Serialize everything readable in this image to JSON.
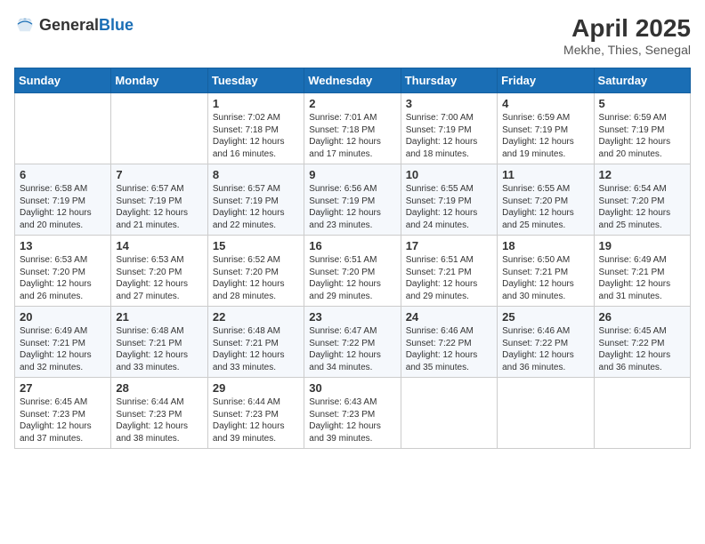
{
  "header": {
    "logo_general": "General",
    "logo_blue": "Blue",
    "month_year": "April 2025",
    "location": "Mekhe, Thies, Senegal"
  },
  "weekdays": [
    "Sunday",
    "Monday",
    "Tuesday",
    "Wednesday",
    "Thursday",
    "Friday",
    "Saturday"
  ],
  "weeks": [
    [
      {
        "day": "",
        "sunrise": "",
        "sunset": "",
        "daylight": ""
      },
      {
        "day": "",
        "sunrise": "",
        "sunset": "",
        "daylight": ""
      },
      {
        "day": "1",
        "sunrise": "Sunrise: 7:02 AM",
        "sunset": "Sunset: 7:18 PM",
        "daylight": "Daylight: 12 hours and 16 minutes."
      },
      {
        "day": "2",
        "sunrise": "Sunrise: 7:01 AM",
        "sunset": "Sunset: 7:18 PM",
        "daylight": "Daylight: 12 hours and 17 minutes."
      },
      {
        "day": "3",
        "sunrise": "Sunrise: 7:00 AM",
        "sunset": "Sunset: 7:19 PM",
        "daylight": "Daylight: 12 hours and 18 minutes."
      },
      {
        "day": "4",
        "sunrise": "Sunrise: 6:59 AM",
        "sunset": "Sunset: 7:19 PM",
        "daylight": "Daylight: 12 hours and 19 minutes."
      },
      {
        "day": "5",
        "sunrise": "Sunrise: 6:59 AM",
        "sunset": "Sunset: 7:19 PM",
        "daylight": "Daylight: 12 hours and 20 minutes."
      }
    ],
    [
      {
        "day": "6",
        "sunrise": "Sunrise: 6:58 AM",
        "sunset": "Sunset: 7:19 PM",
        "daylight": "Daylight: 12 hours and 20 minutes."
      },
      {
        "day": "7",
        "sunrise": "Sunrise: 6:57 AM",
        "sunset": "Sunset: 7:19 PM",
        "daylight": "Daylight: 12 hours and 21 minutes."
      },
      {
        "day": "8",
        "sunrise": "Sunrise: 6:57 AM",
        "sunset": "Sunset: 7:19 PM",
        "daylight": "Daylight: 12 hours and 22 minutes."
      },
      {
        "day": "9",
        "sunrise": "Sunrise: 6:56 AM",
        "sunset": "Sunset: 7:19 PM",
        "daylight": "Daylight: 12 hours and 23 minutes."
      },
      {
        "day": "10",
        "sunrise": "Sunrise: 6:55 AM",
        "sunset": "Sunset: 7:19 PM",
        "daylight": "Daylight: 12 hours and 24 minutes."
      },
      {
        "day": "11",
        "sunrise": "Sunrise: 6:55 AM",
        "sunset": "Sunset: 7:20 PM",
        "daylight": "Daylight: 12 hours and 25 minutes."
      },
      {
        "day": "12",
        "sunrise": "Sunrise: 6:54 AM",
        "sunset": "Sunset: 7:20 PM",
        "daylight": "Daylight: 12 hours and 25 minutes."
      }
    ],
    [
      {
        "day": "13",
        "sunrise": "Sunrise: 6:53 AM",
        "sunset": "Sunset: 7:20 PM",
        "daylight": "Daylight: 12 hours and 26 minutes."
      },
      {
        "day": "14",
        "sunrise": "Sunrise: 6:53 AM",
        "sunset": "Sunset: 7:20 PM",
        "daylight": "Daylight: 12 hours and 27 minutes."
      },
      {
        "day": "15",
        "sunrise": "Sunrise: 6:52 AM",
        "sunset": "Sunset: 7:20 PM",
        "daylight": "Daylight: 12 hours and 28 minutes."
      },
      {
        "day": "16",
        "sunrise": "Sunrise: 6:51 AM",
        "sunset": "Sunset: 7:20 PM",
        "daylight": "Daylight: 12 hours and 29 minutes."
      },
      {
        "day": "17",
        "sunrise": "Sunrise: 6:51 AM",
        "sunset": "Sunset: 7:21 PM",
        "daylight": "Daylight: 12 hours and 29 minutes."
      },
      {
        "day": "18",
        "sunrise": "Sunrise: 6:50 AM",
        "sunset": "Sunset: 7:21 PM",
        "daylight": "Daylight: 12 hours and 30 minutes."
      },
      {
        "day": "19",
        "sunrise": "Sunrise: 6:49 AM",
        "sunset": "Sunset: 7:21 PM",
        "daylight": "Daylight: 12 hours and 31 minutes."
      }
    ],
    [
      {
        "day": "20",
        "sunrise": "Sunrise: 6:49 AM",
        "sunset": "Sunset: 7:21 PM",
        "daylight": "Daylight: 12 hours and 32 minutes."
      },
      {
        "day": "21",
        "sunrise": "Sunrise: 6:48 AM",
        "sunset": "Sunset: 7:21 PM",
        "daylight": "Daylight: 12 hours and 33 minutes."
      },
      {
        "day": "22",
        "sunrise": "Sunrise: 6:48 AM",
        "sunset": "Sunset: 7:21 PM",
        "daylight": "Daylight: 12 hours and 33 minutes."
      },
      {
        "day": "23",
        "sunrise": "Sunrise: 6:47 AM",
        "sunset": "Sunset: 7:22 PM",
        "daylight": "Daylight: 12 hours and 34 minutes."
      },
      {
        "day": "24",
        "sunrise": "Sunrise: 6:46 AM",
        "sunset": "Sunset: 7:22 PM",
        "daylight": "Daylight: 12 hours and 35 minutes."
      },
      {
        "day": "25",
        "sunrise": "Sunrise: 6:46 AM",
        "sunset": "Sunset: 7:22 PM",
        "daylight": "Daylight: 12 hours and 36 minutes."
      },
      {
        "day": "26",
        "sunrise": "Sunrise: 6:45 AM",
        "sunset": "Sunset: 7:22 PM",
        "daylight": "Daylight: 12 hours and 36 minutes."
      }
    ],
    [
      {
        "day": "27",
        "sunrise": "Sunrise: 6:45 AM",
        "sunset": "Sunset: 7:23 PM",
        "daylight": "Daylight: 12 hours and 37 minutes."
      },
      {
        "day": "28",
        "sunrise": "Sunrise: 6:44 AM",
        "sunset": "Sunset: 7:23 PM",
        "daylight": "Daylight: 12 hours and 38 minutes."
      },
      {
        "day": "29",
        "sunrise": "Sunrise: 6:44 AM",
        "sunset": "Sunset: 7:23 PM",
        "daylight": "Daylight: 12 hours and 39 minutes."
      },
      {
        "day": "30",
        "sunrise": "Sunrise: 6:43 AM",
        "sunset": "Sunset: 7:23 PM",
        "daylight": "Daylight: 12 hours and 39 minutes."
      },
      {
        "day": "",
        "sunrise": "",
        "sunset": "",
        "daylight": ""
      },
      {
        "day": "",
        "sunrise": "",
        "sunset": "",
        "daylight": ""
      },
      {
        "day": "",
        "sunrise": "",
        "sunset": "",
        "daylight": ""
      }
    ]
  ]
}
